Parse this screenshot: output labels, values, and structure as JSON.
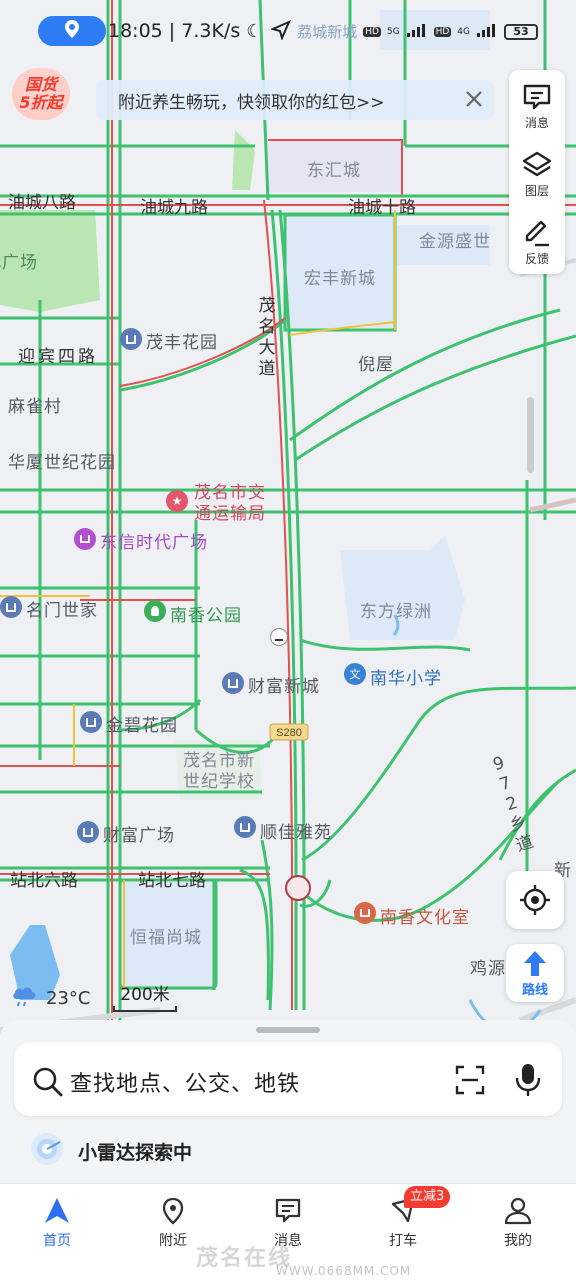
{
  "status_bar": {
    "time_speed": "18:05 | 7.3K/s",
    "signal_5g": "5G",
    "signal_4g": "4G",
    "hd1": "HD",
    "hd2": "HD",
    "battery": "53",
    "faded_label": "荔城新城"
  },
  "promo": {
    "badge_line1": "国货",
    "badge_line2": "5折起",
    "banner_text": "附近养生畅玩，快领取你的红包>>"
  },
  "tools": {
    "message": "消息",
    "layers": "图层",
    "feedback": "反馈"
  },
  "map": {
    "roads": {
      "youcheng8": "油城八路",
      "youcheng9": "油城九路",
      "youcheng10": "油城十路",
      "yingbin4": "迎宾四路",
      "zhanbei6": "站北六路",
      "zhanbei7": "站北七路",
      "maoming_ave": "茂名大道",
      "route_972": "972乡道",
      "s280": "S280"
    },
    "areas": {
      "donghuicheng": "东汇城",
      "jinyuanshengshi": "金源盛世",
      "hongfeng": "宏丰新城",
      "nicun": "倪屋",
      "majuecun": "麻雀村",
      "huaxia": "华厦世纪花园",
      "park_left": "北广场",
      "dongfang": "东方绿洲",
      "shiji_school": "茂名市新世纪学校",
      "hengfu": "恒福尚城",
      "jiyuan": "鸡源",
      "xin": "新"
    },
    "pois": {
      "maofeng": "茂丰花园",
      "jiaotong_l1": "茂名市交",
      "jiaotong_l2": "通运输局",
      "dongxin": "东信时代广场",
      "mingmen": "名门世家",
      "nanxiang_park": "南香公园",
      "caifu_xincheng": "财富新城",
      "nanhua_school": "南华小学",
      "jinbi": "金碧花园",
      "caifu_plaza": "财富广场",
      "shunjia": "顺佳雅苑",
      "nanxiang_culture": "南香文化室"
    },
    "weather": "23°C",
    "scale": "200米"
  },
  "route_button": "路线",
  "search": {
    "placeholder": "查找地点、公交、地铁"
  },
  "radar": "小雷达探索中",
  "tabs": [
    {
      "label": "首页"
    },
    {
      "label": "附近"
    },
    {
      "label": "消息"
    },
    {
      "label": "打车"
    },
    {
      "label": "我的"
    }
  ],
  "taxi_badge": "立减3",
  "watermark": "茂名在线",
  "watermark_url": "WWW.0668MM.COM",
  "colors": {
    "traffic_green": "#3ec26f",
    "traffic_red": "#e0514f",
    "traffic_yellow": "#f2c23e",
    "brand_blue": "#2e7cf6"
  }
}
